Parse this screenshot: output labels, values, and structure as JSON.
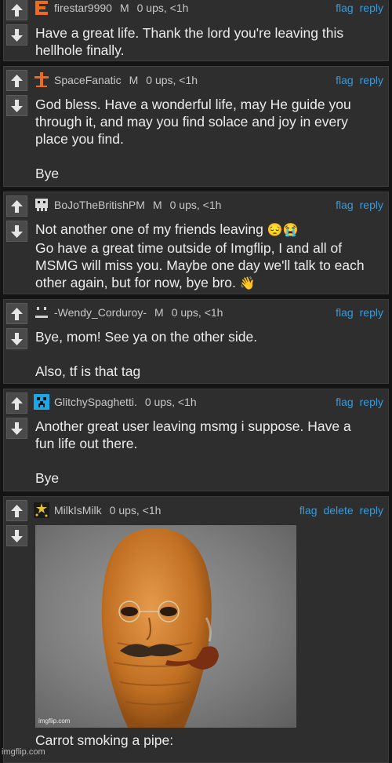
{
  "comments": [
    {
      "username": "firestar9990",
      "badge": "M",
      "meta": "0 ups, <1h",
      "links": [
        "flag",
        "reply"
      ],
      "text": "Have a great life. Thank the lord you're leaving this\nhellhole finally.",
      "avatar_icon": "letter-e-avatar-icon"
    },
    {
      "username": "SpaceFanatic",
      "badge": "M",
      "meta": "0 ups, <1h",
      "links": [
        "flag",
        "reply"
      ],
      "text": "God bless. Have a wonderful life, may He guide you\nthrough it, and may you find solace and joy in every\nplace you find.\n\nBye",
      "avatar_icon": "cross-avatar-icon"
    },
    {
      "username": "BoJoTheBritishPM",
      "badge": "M",
      "meta": "0 ups, <1h",
      "links": [
        "flag",
        "reply"
      ],
      "text_line1": "Not another one of my friends leaving",
      "emoji1": "😔😭",
      "text_mid": "\nGo have a great time outside of Imgflip, I and all of\nMSMG will miss you. Maybe one day we'll talk to each\nother again, but for now, bye bro.",
      "emoji2": "👋",
      "avatar_icon": "pixel-skull-avatar-icon"
    },
    {
      "username": "-Wendy_Corduroy-",
      "badge": "M",
      "meta": "0 ups, <1h",
      "links": [
        "flag",
        "reply"
      ],
      "text": "Bye, mom! See ya on the other side.\n\nAlso, tf is that tag",
      "avatar_icon": "pixel-face-avatar-icon"
    },
    {
      "username": "GlitchySpaghetti.",
      "meta": "0 ups, <1h",
      "links": [
        "flag",
        "reply"
      ],
      "text": "Another great user leaving msmg i suppose. Have a\nfun life out there.\n\nBye",
      "avatar_icon": "blue-pixel-avatar-icon"
    },
    {
      "username": "MilkIsMilk",
      "meta": "0 ups, <1h",
      "links": [
        "flag",
        "delete",
        "reply"
      ],
      "caption": "Carrot smoking a pipe:",
      "image_watermark": "imgflip.com",
      "avatar_icon": "stars-avatar-icon"
    }
  ],
  "site_watermark": "imgflip.com",
  "colors": {
    "link": "#3a9ad9",
    "card": "#2e2e2e",
    "background": "#141414"
  }
}
